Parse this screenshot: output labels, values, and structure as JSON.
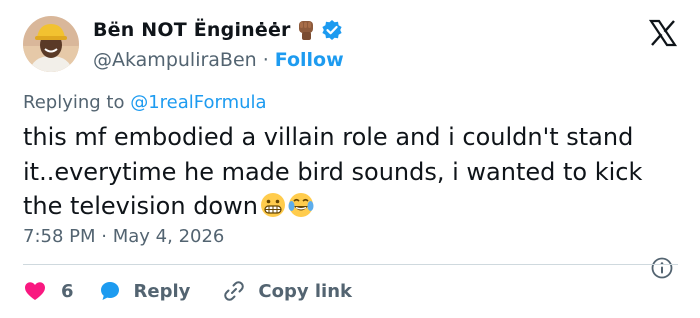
{
  "author": {
    "display_name": "Bën NOT Ënginėėr",
    "handle": "@AkampuliraBen",
    "follow_label": "Follow",
    "separator": "·",
    "avatar_icon": "avatar-photo",
    "name_emoji": "raised-fist-dark-skin-emoji",
    "verified_icon": "verified-badge",
    "verified_color": "#1d9bf0"
  },
  "platform_logo": "x-logo",
  "replying_to": {
    "prefix": "Replying to ",
    "mention": "@1realFormula"
  },
  "tweet": {
    "text": "this mf embodied a villain role and i couldn't stand it..everytime he made bird sounds, i wanted to kick the television down",
    "emojis": [
      "grimacing-face-emoji",
      "face-with-tears-of-joy-emoji"
    ]
  },
  "timestamp": {
    "time": "7:58 PM",
    "separator": "·",
    "date": "May 4, 2026"
  },
  "actions": {
    "like_count": "6",
    "reply_label": "Reply",
    "copy_link_label": "Copy link"
  },
  "colors": {
    "accent": "#1d9bf0",
    "like": "#f91880",
    "text_secondary": "#536471",
    "divider": "#cfd9de"
  }
}
